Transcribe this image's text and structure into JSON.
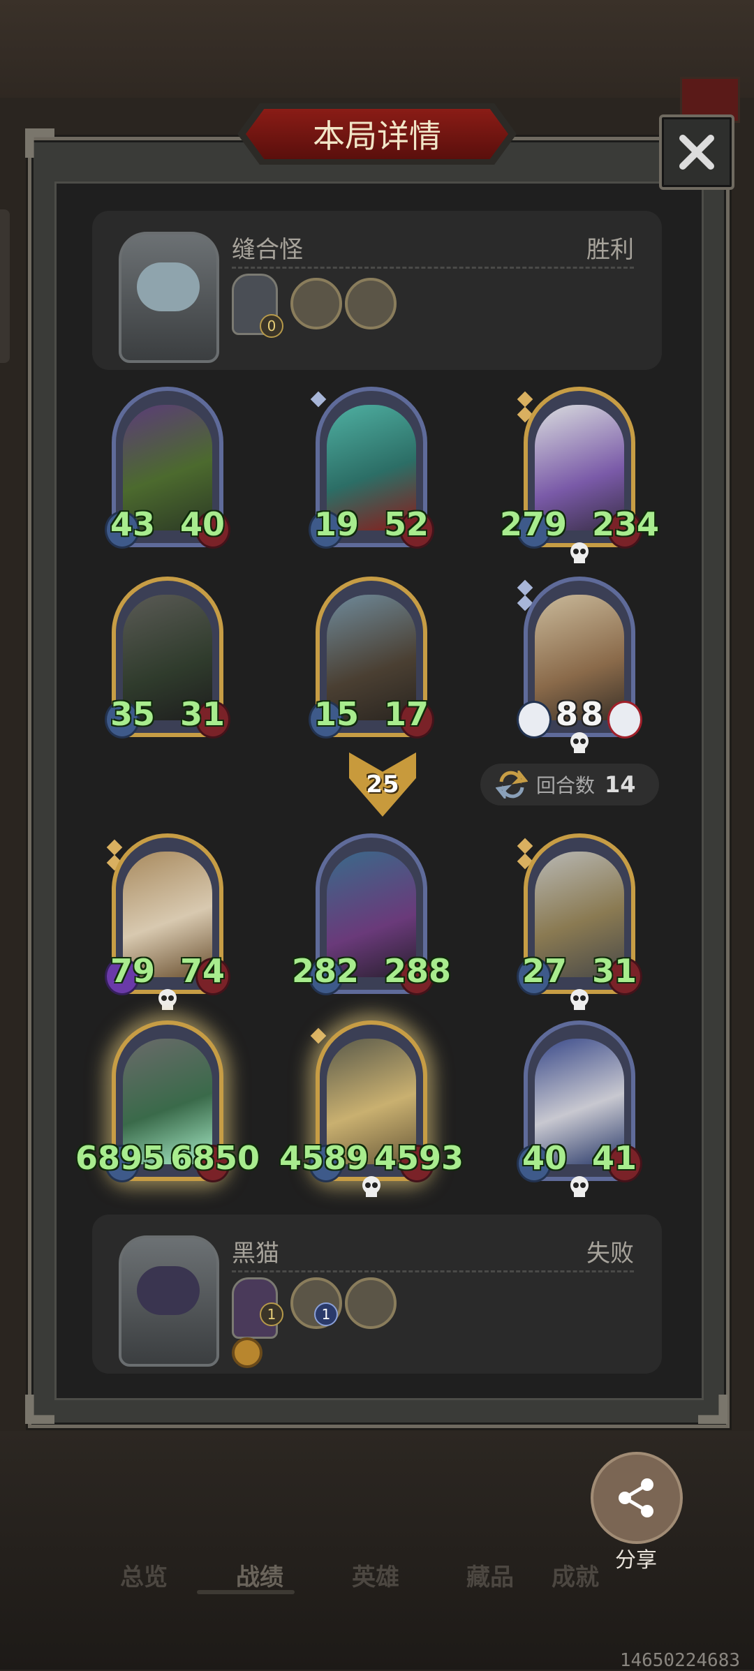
{
  "title": "本局详情",
  "players": {
    "top": {
      "name": "缝合怪",
      "result": "胜利",
      "hero_gear_level": "0"
    },
    "bottom": {
      "name": "黑猫",
      "result": "失败",
      "hero_gear_level": "1",
      "item_badge": "1"
    }
  },
  "top_board": [
    [
      {
        "atk": "43",
        "hp": "40"
      },
      {
        "atk": "19",
        "hp": "52"
      },
      {
        "atk": "279",
        "hp": "234"
      }
    ],
    [
      {
        "atk": "35",
        "hp": "31"
      },
      {
        "atk": "15",
        "hp": "17"
      },
      {
        "atk": "8",
        "hp": "8"
      }
    ]
  ],
  "damage": "25",
  "rounds": {
    "label": "回合数",
    "value": "14"
  },
  "bottom_board": [
    [
      {
        "atk": "79",
        "hp": "74"
      },
      {
        "atk": "282",
        "hp": "288"
      },
      {
        "atk": "27",
        "hp": "31"
      }
    ],
    [
      {
        "atk": "6895",
        "hp": "6850"
      },
      {
        "atk": "4589",
        "hp": "4593"
      },
      {
        "atk": "40",
        "hp": "41"
      }
    ]
  ],
  "share": "分享",
  "nav": [
    "总览",
    "战绩",
    "英雄",
    "藏品",
    "成就"
  ],
  "uid": "14650224683",
  "colors": {
    "stat_green": "#a8ec8e",
    "title_red": "#8a1c16",
    "gold_frame": "#c79d45",
    "blue_frame": "#5f6b9a"
  }
}
